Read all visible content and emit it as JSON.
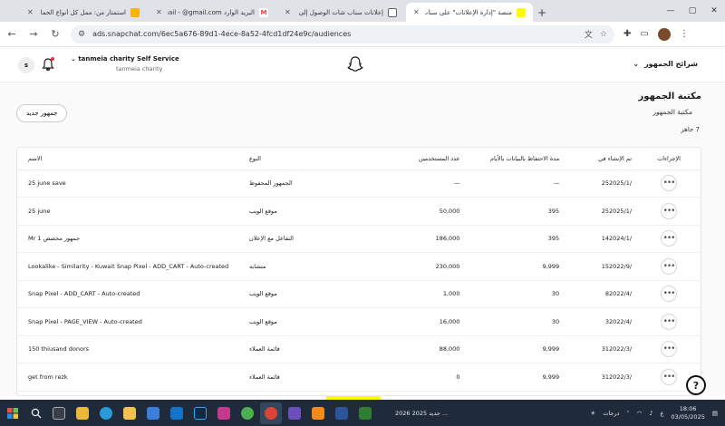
{
  "browser": {
    "tabs": [
      {
        "title": "استمتار من: ممل كل أنواع الحما",
        "color": "#f4b400",
        "glyph": "",
        "active": false
      },
      {
        "title": "البريد الوارد Gmail - @gmail.com",
        "color": "#ea4335",
        "glyph": "M",
        "active": false
      },
      {
        "title": "إعلانات سناب شات الوصول إلى",
        "color": "#9aa0a6",
        "glyph": "",
        "active": false
      },
      {
        "title": "منصة \"إدارة الإعلانات\" على سناب",
        "color": "#fffc00",
        "glyph": "",
        "active": true
      }
    ],
    "new_tab_label": "+",
    "url": "ads.snapchat.com/6ec5a676-89d1-4ece-8a52-4fcd1df24e9c/audiences"
  },
  "header": {
    "avatar_letter": "s",
    "account_name": "tanmeia charity Self Service",
    "account_sub": "tanmeia charity",
    "audience_menu_label": "شرائح الجمهور"
  },
  "page": {
    "title": "مكتبة الجمهور",
    "subtitle": "مكتبة الجمهور",
    "ready_count": "7 جاهز",
    "new_audience_button": "جمهور جديد"
  },
  "table": {
    "headers": {
      "name": "الاسم",
      "type": "النوع",
      "users": "عدد المستخدمين",
      "retention": "مدة الاحتفاظ بالبيانات بالأيام",
      "created": "تم الإنشاء في",
      "actions": "الإجراءات"
    },
    "rows": [
      {
        "name": "25 june save",
        "type": "الجمهور المحفوظ",
        "users": "—",
        "retention": "—",
        "created": "252025/1/"
      },
      {
        "name": "25 june",
        "type": "موقع الويب",
        "users": "50,000",
        "retention": "395",
        "created": "252025/1/"
      },
      {
        "name": "Mr 1 جمهور مخصص",
        "type": "التفاعل مع الإعلان",
        "users": "186,000",
        "retention": "395",
        "created": "142024/1/"
      },
      {
        "name": "Lookalike - Similarity - Kuwait Snap Pixel - ADD_CART - Auto-created",
        "type": "متشابه",
        "users": "230,000",
        "retention": "9,999",
        "created": "152022/9/"
      },
      {
        "name": "Snap Pixel - ADD_CART - Auto-created",
        "type": "موقع الويب",
        "users": "1,000",
        "retention": "30",
        "created": "82022/4/"
      },
      {
        "name": "Snap Pixel - PAGE_VIEW - Auto-created",
        "type": "موقع الويب",
        "users": "16,000",
        "retention": "30",
        "created": "32022/4/"
      },
      {
        "name": "150 thiusand donors",
        "type": "قائمة العملاء",
        "users": "88,000",
        "retention": "9,999",
        "created": "312022/3/"
      },
      {
        "name": "get from rezk",
        "type": "قائمة العملاء",
        "users": "0",
        "retention": "9,999",
        "created": "312022/3/"
      }
    ],
    "more_glyph": "•••"
  },
  "help_glyph": "?",
  "taskbar": {
    "news": "2026 جديد 2025 ...",
    "weather": "درجات",
    "lang": "ع",
    "time": "18:06",
    "date": "03/05/2025"
  },
  "colors": {
    "snap_yellow": "#fffc00",
    "taskbar": "#1f2a3a",
    "notification": "#e3344b"
  }
}
